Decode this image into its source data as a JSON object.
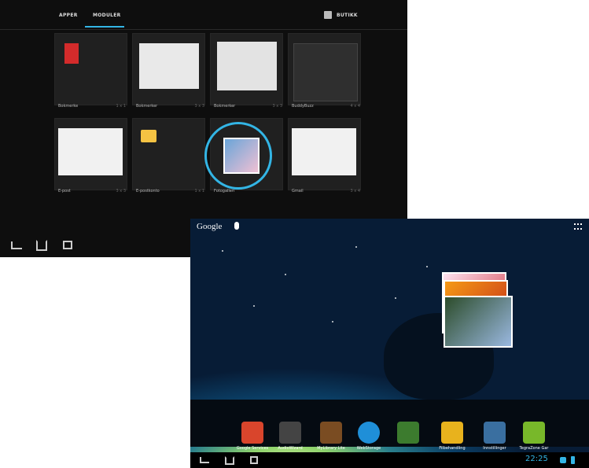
{
  "picker": {
    "tabs": [
      "APPER",
      "MODULER"
    ],
    "store_label": "BUTIKK",
    "tiles": [
      {
        "label": "Bokmerke",
        "size": "1 x 1"
      },
      {
        "label": "Bokmerker",
        "size": "3 x 3"
      },
      {
        "label": "Bokmerker",
        "size": "3 x 3"
      },
      {
        "label": "BuddyBuzz",
        "size": "4 x 4"
      },
      {
        "label": "E-post",
        "size": "3 x 3"
      },
      {
        "label": "E-postkonto",
        "size": "1 x 1"
      },
      {
        "label": "Fotogalleri",
        "size": ""
      },
      {
        "label": "Gmail",
        "size": "3 x 4"
      }
    ]
  },
  "home": {
    "search_label": "Google",
    "apps": [
      {
        "label": "Google Services",
        "color": "#d9452c"
      },
      {
        "label": "AudioWizard",
        "color": "#444444"
      },
      {
        "label": "MyLibrary Lite",
        "color": "#7a4c22"
      },
      {
        "label": "WebStorage",
        "color": "#1f8fd8"
      },
      {
        "label": "",
        "color": "#3c7b2e"
      },
      {
        "label": "Filbehandling",
        "color": "#e8b21d"
      },
      {
        "label": "Innstillinger",
        "color": "#3a6fa0"
      },
      {
        "label": "TegraZone Gar",
        "color": "#78b82a"
      }
    ],
    "time": "22:25"
  },
  "colors": {
    "accent": "#33b5e5"
  }
}
